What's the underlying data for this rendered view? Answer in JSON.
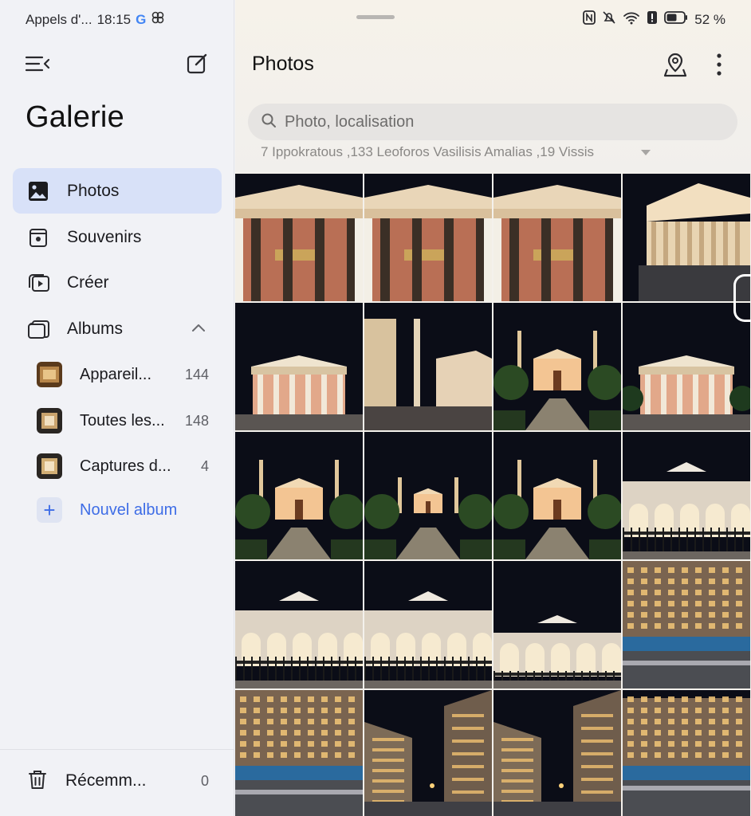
{
  "status_bar": {
    "carrier": "Appels d'...",
    "time": "18:15",
    "battery": "52 %"
  },
  "sidebar": {
    "title": "Galerie",
    "nav": [
      {
        "label": "Photos",
        "icon": "image-icon",
        "active": true
      },
      {
        "label": "Souvenirs",
        "icon": "memories-icon"
      },
      {
        "label": "Créer",
        "icon": "create-icon"
      },
      {
        "label": "Albums",
        "icon": "albums-icon"
      }
    ],
    "albums": [
      {
        "name": "Appareil...",
        "count": "144"
      },
      {
        "name": "Toutes les...",
        "count": "148"
      },
      {
        "name": "Captures d...",
        "count": "4"
      }
    ],
    "new_album": "Nouvel album",
    "trash": {
      "label": "Récemm...",
      "count": "0"
    }
  },
  "main": {
    "title": "Photos",
    "search_placeholder": "Photo, localisation",
    "location": "7 Ippokratous ,133 Leoforos Vasilisis Amalias ,19 Vissis"
  },
  "colors": {
    "accent": "#3e6de6",
    "active_bg": "#d8e1f8"
  }
}
